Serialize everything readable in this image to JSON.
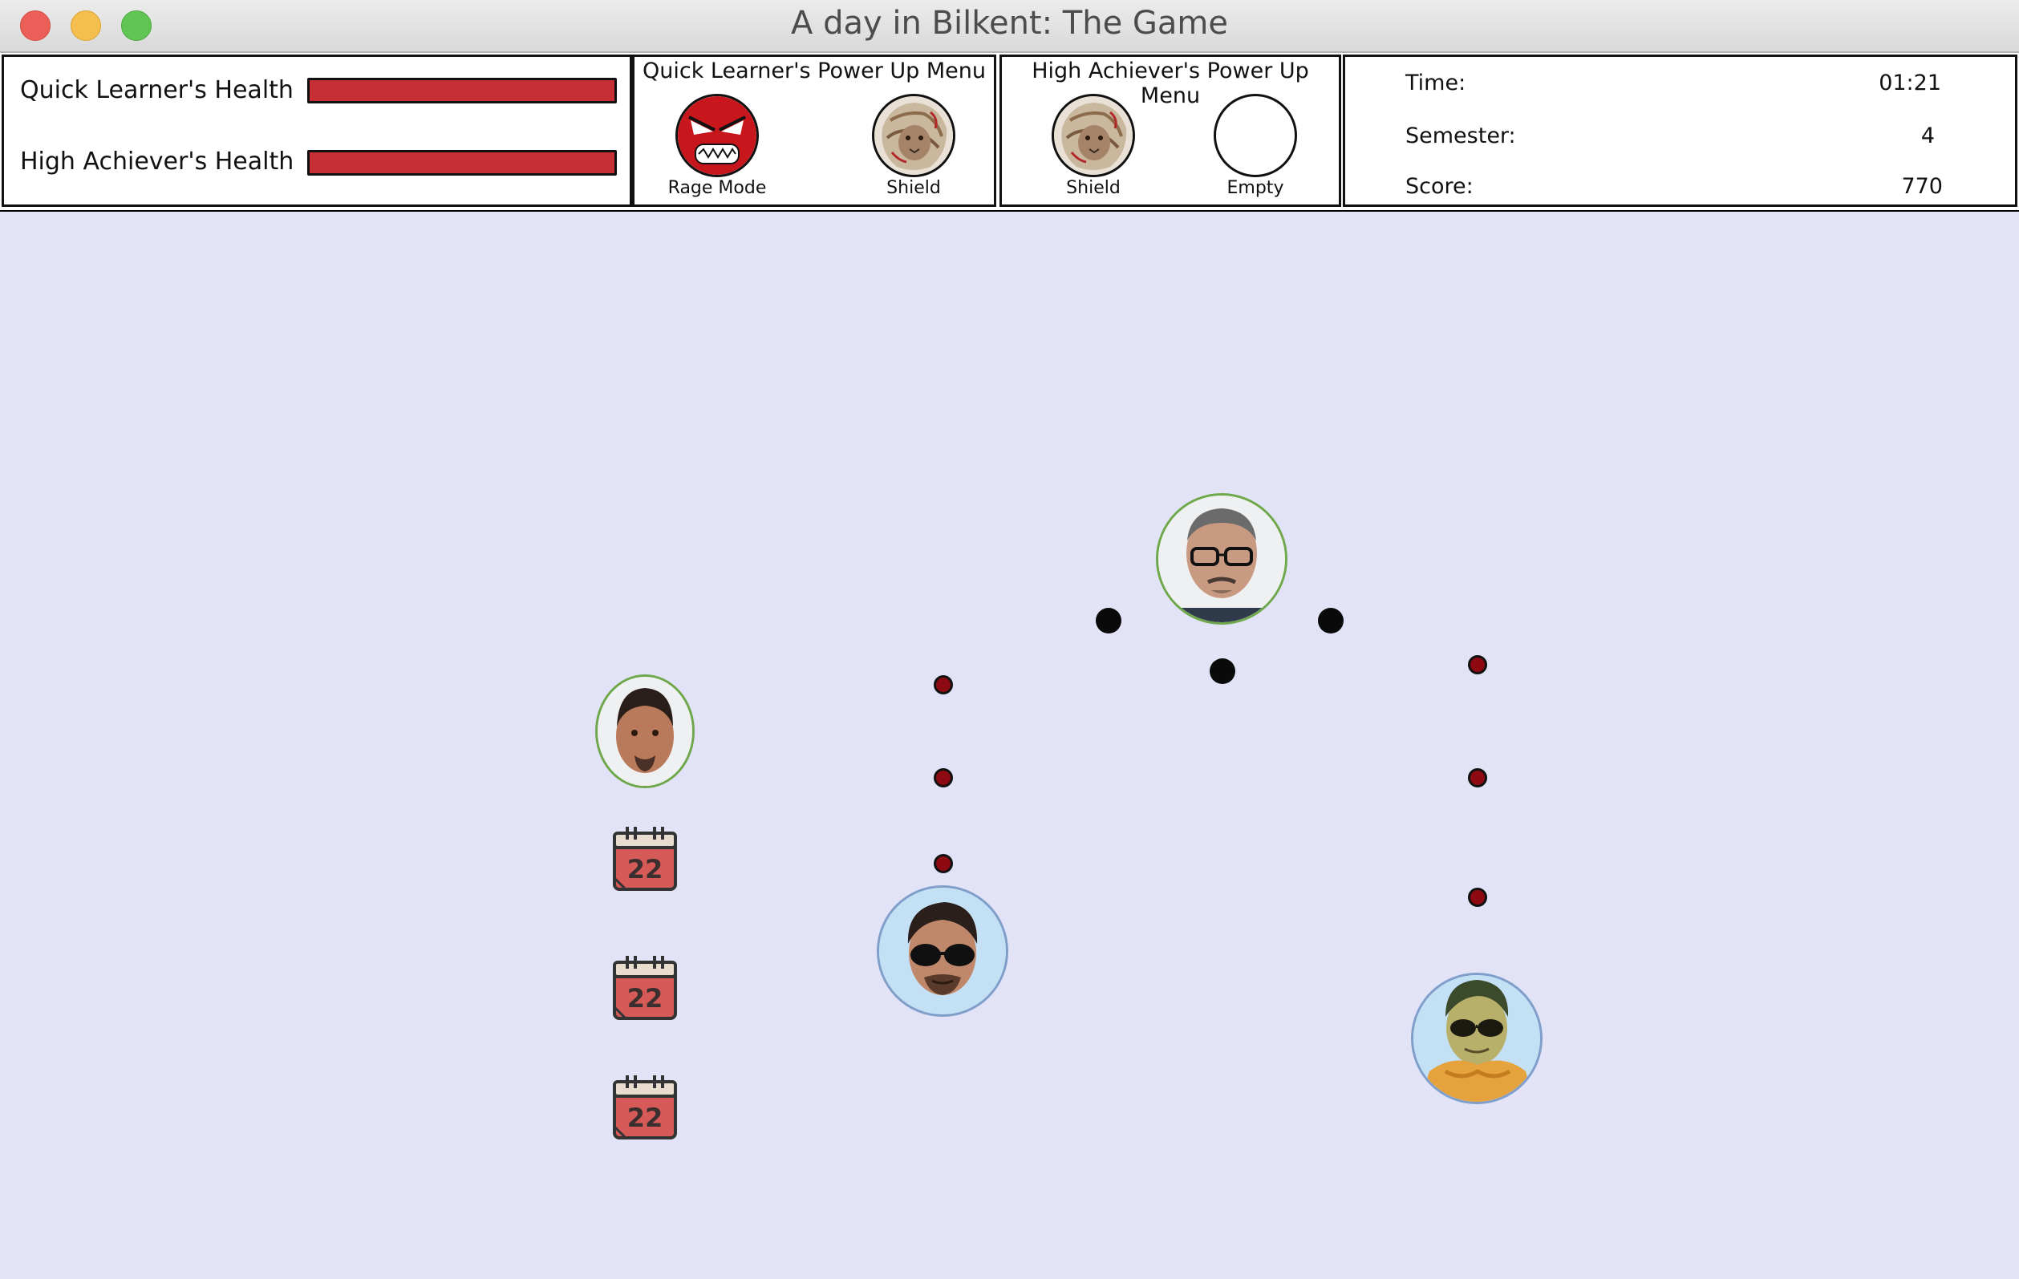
{
  "window": {
    "title": "A day in Bilkent: The Game"
  },
  "health": {
    "quick_learner_label": "Quick Learner's Health",
    "quick_learner_value": 1.0,
    "high_achiever_label": "High Achiever's Health",
    "high_achiever_value": 1.0,
    "bar_color": "#c62f36"
  },
  "quick_learner_menu": {
    "title": "Quick Learner's Power Up Menu",
    "slots": [
      {
        "label": "Rage Mode",
        "icon": "rage-face-icon"
      },
      {
        "label": "Shield",
        "icon": "shield-lion-icon"
      }
    ]
  },
  "high_achiever_menu": {
    "title": "High Achiever's Power Up Menu",
    "slots": [
      {
        "label": "Shield",
        "icon": "shield-lion-icon"
      },
      {
        "label": "Empty",
        "icon": "empty-slot-icon"
      }
    ]
  },
  "stats": {
    "time_label": "Time:",
    "time_value": "01:21",
    "semester_label": "Semester:",
    "semester_value": "4",
    "score_label": "Score:",
    "score_value": "770"
  },
  "field": {
    "background": "#e3e3f7",
    "calendar_number": "22",
    "calendar_count": 3,
    "enemy_bullet_color": "#0a0a0a",
    "player_bullet_color": "#8e0a12"
  }
}
